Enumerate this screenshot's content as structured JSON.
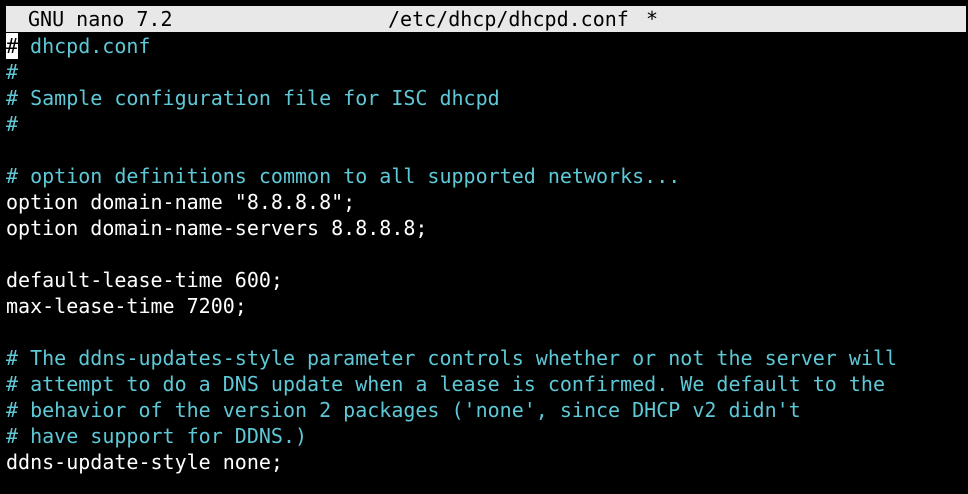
{
  "titlebar": {
    "app": "GNU nano 7.2",
    "file": "/etc/dhcp/dhcpd.conf",
    "modified": "*"
  },
  "editor": {
    "cursor_char": "#",
    "lines": [
      {
        "type": "comment",
        "text": " dhcpd.conf"
      },
      {
        "type": "comment",
        "text": "#"
      },
      {
        "type": "comment",
        "text": "# Sample configuration file for ISC dhcpd"
      },
      {
        "type": "comment",
        "text": "#"
      },
      {
        "type": "blank",
        "text": ""
      },
      {
        "type": "comment",
        "text": "# option definitions common to all supported networks..."
      },
      {
        "type": "code",
        "text": "option domain-name \"8.8.8.8\";"
      },
      {
        "type": "code",
        "text": "option domain-name-servers 8.8.8.8;"
      },
      {
        "type": "blank",
        "text": ""
      },
      {
        "type": "code",
        "text": "default-lease-time 600;"
      },
      {
        "type": "code",
        "text": "max-lease-time 7200;"
      },
      {
        "type": "blank",
        "text": ""
      },
      {
        "type": "comment",
        "text": "# The ddns-updates-style parameter controls whether or not the server will"
      },
      {
        "type": "comment",
        "text": "# attempt to do a DNS update when a lease is confirmed. We default to the"
      },
      {
        "type": "comment",
        "text": "# behavior of the version 2 packages ('none', since DHCP v2 didn't"
      },
      {
        "type": "comment",
        "text": "# have support for DDNS.)"
      },
      {
        "type": "code",
        "text": "ddns-update-style none;"
      }
    ]
  },
  "colors": {
    "background": "#000000",
    "titlebar_bg": "#e8e8e8",
    "comment": "#5ec8d6",
    "code": "#ffffff"
  }
}
